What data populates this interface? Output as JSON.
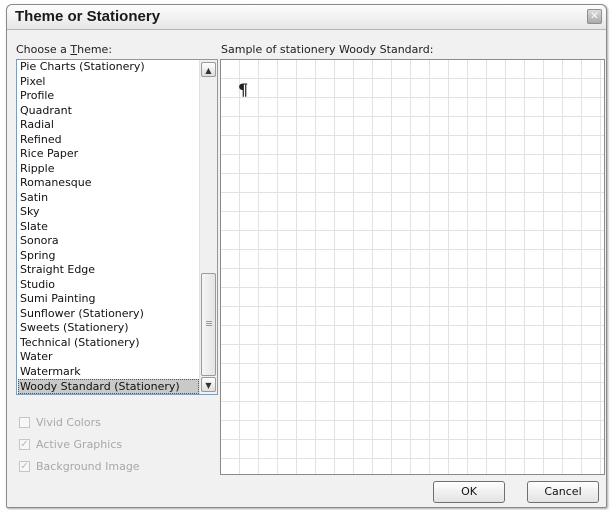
{
  "window": {
    "title": "Theme or Stationery",
    "close_glyph": "✕"
  },
  "theme_list": {
    "label_prefix": "Choose a ",
    "label_accesskey": "T",
    "label_suffix": "heme:",
    "items": [
      "Pie Charts (Stationery)",
      "Pixel",
      "Profile",
      "Quadrant",
      "Radial",
      "Refined",
      "Rice Paper",
      "Ripple",
      "Romanesque",
      "Satin",
      "Sky",
      "Slate",
      "Sonora",
      "Spring",
      "Straight Edge",
      "Studio",
      "Sumi Painting",
      "Sunflower (Stationery)",
      "Sweets (Stationery)",
      "Technical (Stationery)",
      "Water",
      "Watermark",
      "Woody Standard (Stationery)"
    ],
    "selected_index": 22,
    "scroll_up_glyph": "▲",
    "scroll_down_glyph": "▼"
  },
  "options": {
    "vivid_colors": {
      "label": "Vivid Colors",
      "checked": false,
      "enabled": false
    },
    "active_graphics": {
      "label": "Active Graphics",
      "checked": true,
      "enabled": false
    },
    "background_image": {
      "label": "Background Image",
      "checked": true,
      "enabled": false
    }
  },
  "preview": {
    "label": "Sample of stationery Woody Standard:",
    "pilcrow": "¶"
  },
  "buttons": {
    "ok": "OK",
    "cancel": "Cancel"
  }
}
